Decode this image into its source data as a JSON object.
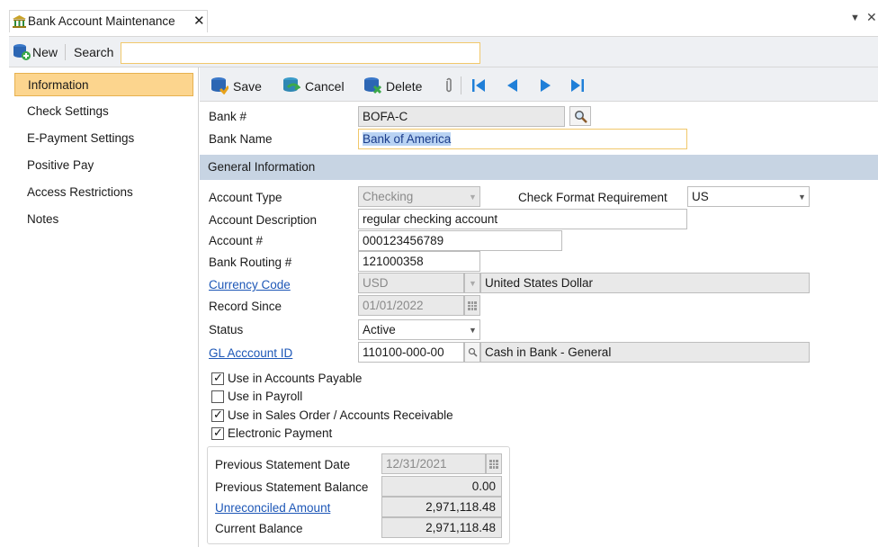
{
  "tab": {
    "title": "Bank Account Maintenance",
    "close": "✕",
    "icon": "bank-icon"
  },
  "window_controls": {
    "pin": "▼",
    "close": "✕"
  },
  "searchbar": {
    "new_label": "New",
    "search_label": "Search",
    "search_value": ""
  },
  "sidebar": {
    "items": [
      {
        "label": "Information",
        "active": true
      },
      {
        "label": "Check Settings"
      },
      {
        "label": "E-Payment Settings"
      },
      {
        "label": "Positive Pay"
      },
      {
        "label": "Access Restrictions"
      },
      {
        "label": "Notes"
      }
    ]
  },
  "toolbar": {
    "save": "Save",
    "cancel": "Cancel",
    "delete": "Delete"
  },
  "header_fields": {
    "bank_no_label": "Bank #",
    "bank_no_value": "BOFA-C",
    "bank_name_label": "Bank Name",
    "bank_name_value": "Bank of America"
  },
  "section": {
    "title": "General Information"
  },
  "form": {
    "account_type_label": "Account Type",
    "account_type_value": "Checking",
    "check_format_label": "Check Format Requirement",
    "check_format_value": "US",
    "account_desc_label": "Account Description",
    "account_desc_value": "regular checking account",
    "account_no_label": "Account #",
    "account_no_value": "000123456789",
    "routing_label": "Bank Routing #",
    "routing_value": "121000358",
    "currency_label": "Currency Code",
    "currency_value": "USD",
    "currency_desc": "United States Dollar",
    "record_since_label": "Record Since",
    "record_since_value": "01/01/2022",
    "status_label": "Status",
    "status_value": "Active",
    "gl_label": "GL Acccount ID",
    "gl_value": "110100-000-00",
    "gl_desc": "Cash in Bank - General"
  },
  "checkboxes": [
    {
      "label": "Use in Accounts Payable",
      "checked": true
    },
    {
      "label": "Use in Payroll",
      "checked": false
    },
    {
      "label": "Use in Sales Order / Accounts Receivable",
      "checked": true
    },
    {
      "label": "Electronic Payment",
      "checked": true
    }
  ],
  "statement": {
    "prev_date_label": "Previous Statement Date",
    "prev_date_value": "12/31/2021",
    "prev_balance_label": "Previous Statement Balance",
    "prev_balance_value": "0.00",
    "unreconciled_label": "Unreconciled Amount",
    "unreconciled_value": "2,971,118.48",
    "current_label": "Current Balance",
    "current_value": "2,971,118.48"
  },
  "colors": {
    "accent": "#fcd58e",
    "section": "#c7d4e3",
    "link": "#1d57b7",
    "nav_blue": "#1f7fd8"
  }
}
